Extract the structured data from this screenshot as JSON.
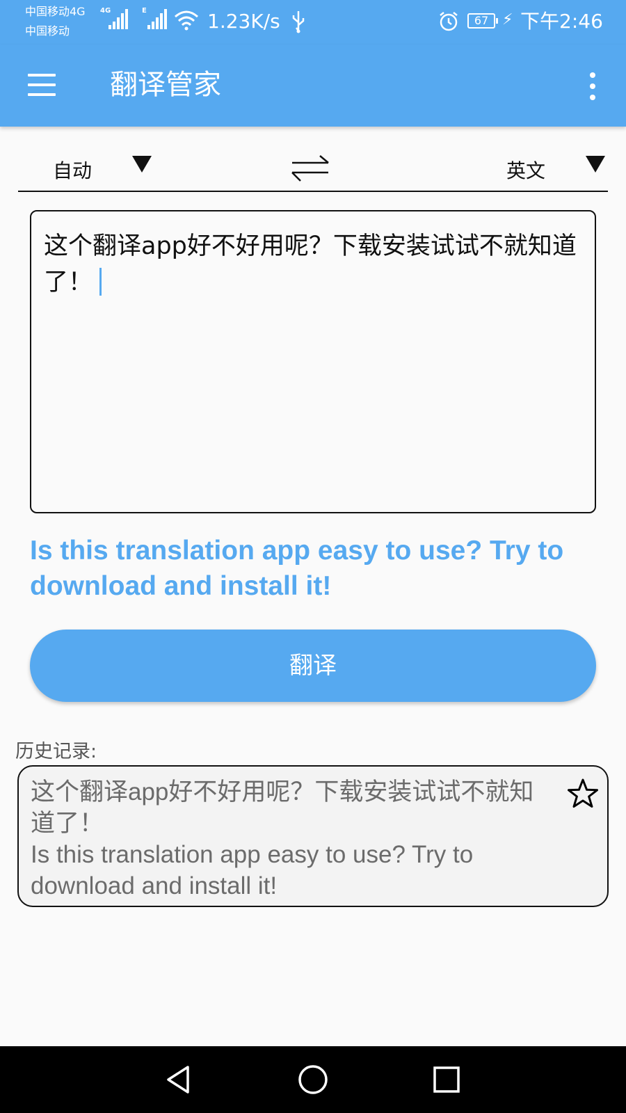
{
  "status_bar": {
    "carrier_1": "中国移动4G",
    "carrier_2": "中国移动",
    "signal_1_tag": "4G",
    "signal_2_tag": "E",
    "net_speed": "1.23K/s",
    "battery": "67",
    "time": "下午2:46",
    "icons": [
      "signal-icon",
      "wifi-icon",
      "usb-icon",
      "alarm-icon",
      "battery-icon",
      "charging-icon"
    ]
  },
  "app_bar": {
    "title": "翻译管家",
    "menu_icon": "hamburger-menu-icon",
    "more_icon": "more-vertical-icon"
  },
  "language": {
    "source": "自动",
    "target": "英文",
    "swap_icon": "swap-arrows-icon"
  },
  "input": {
    "value": "这个翻译app好不好用呢？下载安装试试不就知道了！"
  },
  "translation": {
    "text": "Is this translation app easy to use? Try to download and install it!"
  },
  "translate_button": {
    "label": "翻译"
  },
  "history": {
    "label": "历史记录:",
    "items": [
      {
        "source": "这个翻译app好不好用呢？下载安装试试不就知道了！",
        "target": "Is this translation app easy to use? Try to download and install it!",
        "favorite_icon": "star-outline-icon"
      }
    ]
  },
  "nav_bar": {
    "icons": [
      "back-icon",
      "home-icon",
      "recents-icon"
    ]
  },
  "colors": {
    "primary": "#56a9f0",
    "background": "#fafafa",
    "history_text": "#6b6b6b"
  }
}
